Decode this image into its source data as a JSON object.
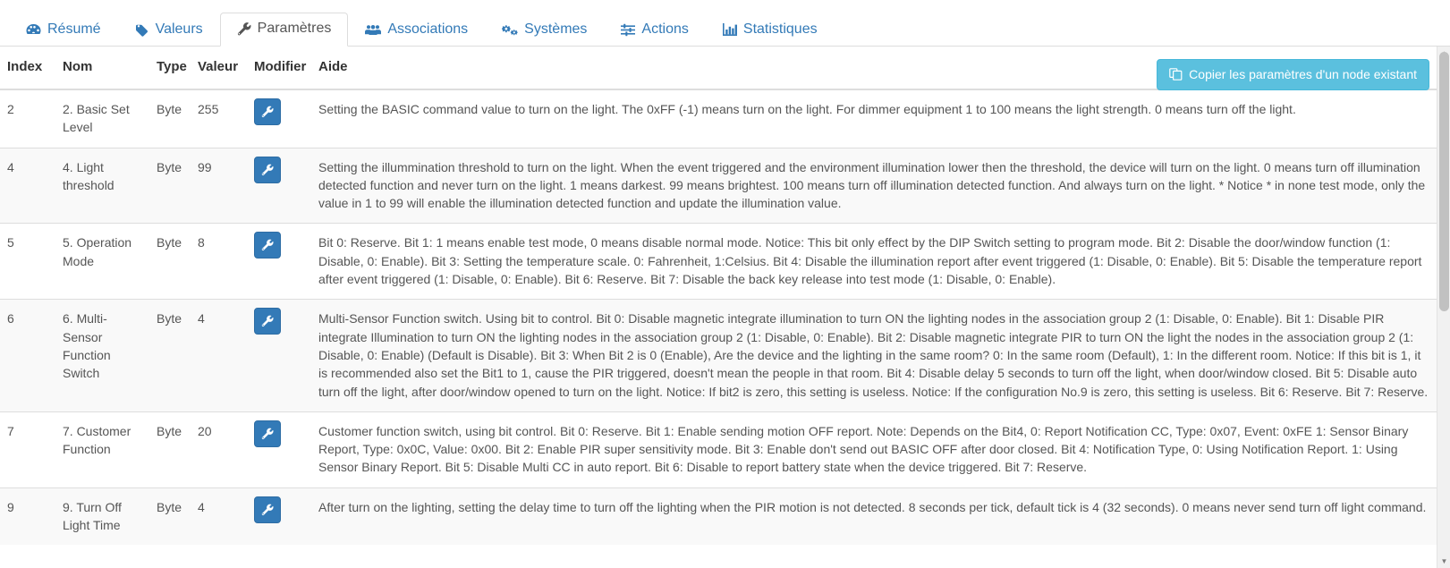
{
  "tabs": [
    {
      "label": "Résumé",
      "icon": "dashboard-icon",
      "active": false
    },
    {
      "label": "Valeurs",
      "icon": "tag-icon",
      "active": false
    },
    {
      "label": "Paramètres",
      "icon": "wrench-icon",
      "active": true
    },
    {
      "label": "Associations",
      "icon": "users-icon",
      "active": false
    },
    {
      "label": "Systèmes",
      "icon": "gears-icon",
      "active": false
    },
    {
      "label": "Actions",
      "icon": "sliders-icon",
      "active": false
    },
    {
      "label": "Statistiques",
      "icon": "bar-chart-icon",
      "active": false
    }
  ],
  "toolbar": {
    "copy_label": "Copier les paramètres d'un node existant",
    "copy_icon": "copy-icon",
    "copy_bg": "#5bc0de"
  },
  "table": {
    "columns": [
      "Index",
      "Nom",
      "Type",
      "Valeur",
      "Modifier",
      "Aide"
    ],
    "edit_icon": "wrench-icon",
    "rows": [
      {
        "index": "2",
        "nom": "2. Basic Set Level",
        "type": "Byte",
        "valeur": "255",
        "aide": "Setting the BASIC command value to turn on the light. The 0xFF (-1) means turn on the light. For dimmer equipment 1 to 100 means the light strength. 0 means turn off the light."
      },
      {
        "index": "4",
        "nom": "4. Light threshold",
        "type": "Byte",
        "valeur": "99",
        "aide": "Setting the illummination threshold to turn on the light. When the event triggered and the environment illumination lower then the threshold, the device will turn on the light. 0 means turn off illumination detected function and never turn on the light. 1 means darkest. 99 means brightest. 100 means turn off illumination detected function. And always turn on the light. * Notice * in none test mode, only the value in 1 to 99 will enable the illumination detected function and update the illumination value."
      },
      {
        "index": "5",
        "nom": "5. Operation Mode",
        "type": "Byte",
        "valeur": "8",
        "aide": "Bit 0: Reserve. Bit 1: 1 means enable test mode, 0 means disable normal mode. Notice: This bit only effect by the DIP Switch setting to program mode. Bit 2: Disable the door/window function (1: Disable, 0: Enable). Bit 3: Setting the temperature scale. 0: Fahrenheit, 1:Celsius. Bit 4: Disable the illumination report after event triggered (1: Disable, 0: Enable). Bit 5: Disable the temperature report after event triggered (1: Disable, 0: Enable). Bit 6: Reserve. Bit 7: Disable the back key release into test mode (1: Disable, 0: Enable)."
      },
      {
        "index": "6",
        "nom": "6. Multi-Sensor Function Switch",
        "type": "Byte",
        "valeur": "4",
        "aide": "Multi-Sensor Function switch. Using bit to control. Bit 0: Disable magnetic integrate illumination to turn ON the lighting nodes in the association group 2 (1: Disable, 0: Enable). Bit 1: Disable PIR integrate Illumination to turn ON the lighting nodes in the association group 2 (1: Disable, 0: Enable). Bit 2: Disable magnetic integrate PIR to turn ON the light the nodes in the association group 2 (1: Disable, 0: Enable) (Default is Disable). Bit 3: When Bit 2 is 0 (Enable), Are the device and the lighting in the same room? 0: In the same room (Default), 1: In the different room. Notice: If this bit is 1, it is recommended also set the Bit1 to 1, cause the PIR triggered, doesn't mean the people in that room. Bit 4: Disable delay 5 seconds to turn off the light, when door/window closed. Bit 5: Disable auto turn off the light, after door/window opened to turn on the light. Notice: If bit2 is zero, this setting is useless. Notice: If the configuration No.9 is zero, this setting is useless. Bit 6: Reserve. Bit 7: Reserve."
      },
      {
        "index": "7",
        "nom": "7. Customer Function",
        "type": "Byte",
        "valeur": "20",
        "aide": "Customer function switch, using bit control. Bit 0: Reserve. Bit 1: Enable sending motion OFF report. Note: Depends on the Bit4, 0: Report Notification CC, Type: 0x07, Event: 0xFE 1: Sensor Binary Report, Type: 0x0C, Value: 0x00. Bit 2: Enable PIR super sensitivity mode. Bit 3: Enable don't send out BASIC OFF after door closed. Bit 4: Notification Type, 0: Using Notification Report. 1: Using Sensor Binary Report. Bit 5: Disable Multi CC in auto report. Bit 6: Disable to report battery state when the device triggered. Bit 7: Reserve."
      },
      {
        "index": "9",
        "nom": "9. Turn Off Light Time",
        "type": "Byte",
        "valeur": "4",
        "aide": "After turn on the lighting, setting the delay time to turn off the lighting when the PIR motion is not detected. 8 seconds per tick, default tick is 4 (32 seconds). 0 means never send turn off light command."
      }
    ]
  }
}
